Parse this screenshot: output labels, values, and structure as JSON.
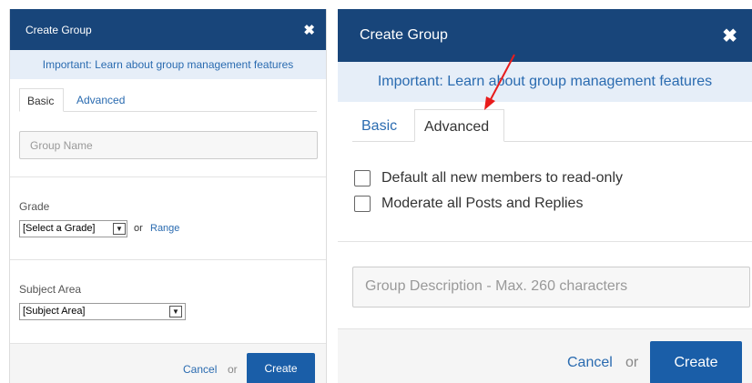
{
  "left_dialog": {
    "title": "Create Group",
    "close_glyph": "✖",
    "notice": "Important: Learn about group management features",
    "tabs": [
      "Basic",
      "Advanced"
    ],
    "group_name_placeholder": "Group Name",
    "grade_label": "Grade",
    "grade_select": "[Select a Grade]",
    "or_text": "or",
    "range_link": "Range",
    "subject_label": "Subject Area",
    "subject_select": "[Subject Area]",
    "cancel_label": "Cancel",
    "footer_or": "or",
    "create_label": "Create"
  },
  "right_dialog": {
    "title": "Create Group",
    "close_glyph": "✖",
    "notice": "Important: Learn about group management features",
    "tabs": [
      "Basic",
      "Advanced"
    ],
    "checkboxes": [
      {
        "label": "Default all new members to read-only",
        "checked": false
      },
      {
        "label": "Moderate all Posts and Replies",
        "checked": false
      }
    ],
    "description_placeholder": "Group Description - Max. 260 characters",
    "cancel_label": "Cancel",
    "footer_or": "or",
    "create_label": "Create"
  },
  "annotation": {
    "arrow_color": "#e81c1c"
  }
}
